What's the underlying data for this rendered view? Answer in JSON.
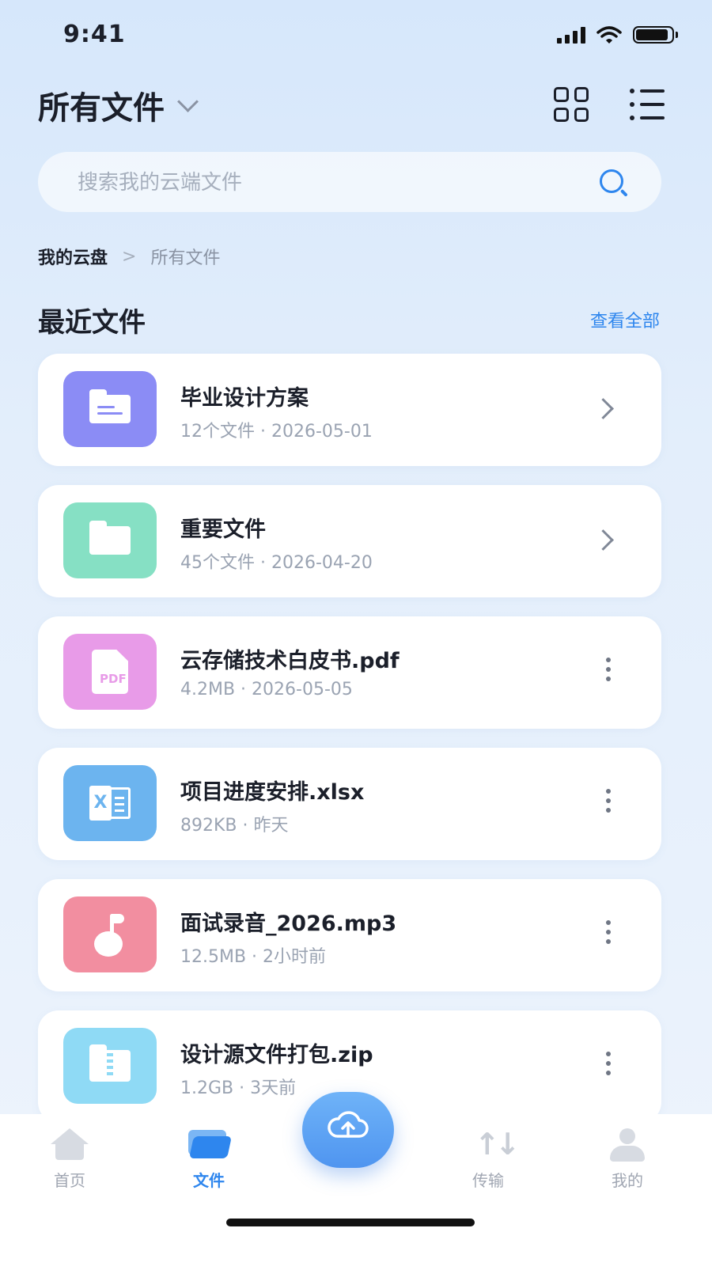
{
  "status_bar": {
    "time": "9:41"
  },
  "header": {
    "title": "所有文件"
  },
  "search": {
    "placeholder": "搜索我的云端文件"
  },
  "breadcrumb": {
    "root": "我的云盘",
    "separator": ">",
    "current": "所有文件"
  },
  "recent": {
    "title": "最近文件",
    "view_all": "查看全部",
    "files": [
      {
        "name": "毕业设计方案",
        "meta": "12个文件 · 2026-05-01",
        "type": "folder",
        "color": "#8b8cf5"
      },
      {
        "name": "重要文件",
        "meta": "45个文件 · 2026-04-20",
        "type": "folder",
        "color": "#86e0c4"
      },
      {
        "name": "云存储技术白皮书.pdf",
        "meta": "4.2MB · 2026-05-05",
        "type": "pdf",
        "color": "#e89be8"
      },
      {
        "name": "项目进度安排.xlsx",
        "meta": "892KB · 昨天",
        "type": "xlsx",
        "color": "#6cb4ef"
      },
      {
        "name": "面试录音_2026.mp3",
        "meta": "12.5MB · 2小时前",
        "type": "mp3",
        "color": "#f28ea0"
      },
      {
        "name": "设计源文件打包.zip",
        "meta": "1.2GB · 3天前",
        "type": "zip",
        "color": "#8fdaf5"
      }
    ]
  },
  "tabbar": {
    "home": "首页",
    "files": "文件",
    "transfer": "传输",
    "me": "我的",
    "active": "files"
  },
  "colors": {
    "accent": "#2e86ee"
  }
}
